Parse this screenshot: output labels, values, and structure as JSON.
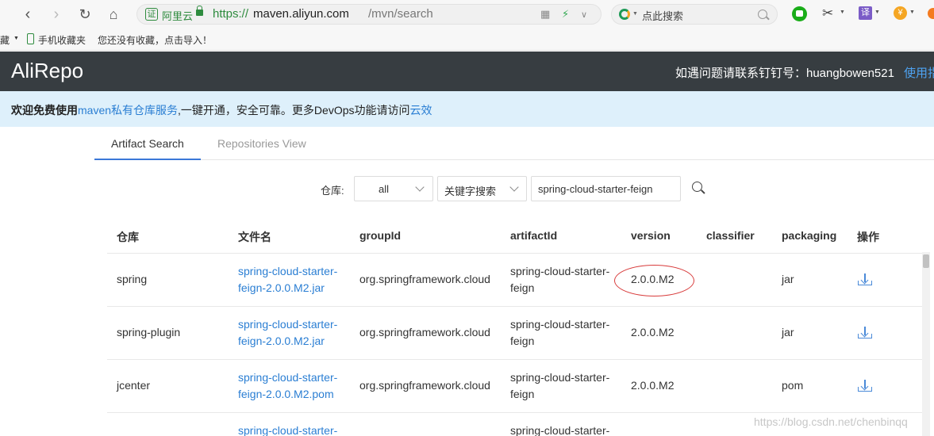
{
  "browser": {
    "site_name": "阿里云",
    "cert_badge": "证",
    "url_scheme": "https://",
    "url_host": "maven.aliyun.com",
    "url_path": "/mvn/search",
    "search_placeholder": "点此搜索",
    "translate_badge": "译",
    "coin_badge": "¥",
    "icons": [
      "back-icon",
      "forward-icon",
      "refresh-icon",
      "home-icon",
      "qr-icon",
      "lightning-icon",
      "chevron-down-icon",
      "search-icon",
      "wechat-icon",
      "scissors-icon",
      "translate-icon",
      "coin-icon"
    ]
  },
  "bookmarks": {
    "folder_label": "藏",
    "mobile_label": "手机收藏夹",
    "hint": "您还没有收藏，点击导入！"
  },
  "app": {
    "logo": "AliRepo",
    "contact": "如遇问题请联系钉钉号：huangbowen521",
    "help_link": "使用指南"
  },
  "notice": {
    "prefix": "欢迎免费使用",
    "link1": "maven私有仓库服务",
    "middle": ",一键开通，安全可靠。更多DevOps功能请访问",
    "link2": "云效"
  },
  "tabs": [
    {
      "label": "Artifact Search",
      "active": true
    },
    {
      "label": "Repositories View",
      "active": false
    }
  ],
  "search": {
    "repo_label": "仓库:",
    "repo_value": "all",
    "mode_value": "关键字搜索",
    "keyword": "spring-cloud-starter-feign"
  },
  "table": {
    "columns": [
      "仓库",
      "文件名",
      "groupId",
      "artifactId",
      "version",
      "classifier",
      "packaging",
      "操作"
    ],
    "rows": [
      {
        "repo": "spring",
        "file_line1": "spring-cloud-starter-",
        "file_line2": "feign-2.0.0.M2.jar",
        "group": "org.springframework.cloud",
        "artifact_line1": "spring-cloud-starter-",
        "artifact_line2": "feign",
        "version": "2.0.0.M2",
        "classifier": "",
        "packaging": "jar"
      },
      {
        "repo": "spring-plugin",
        "file_line1": "spring-cloud-starter-",
        "file_line2": "feign-2.0.0.M2.jar",
        "group": "org.springframework.cloud",
        "artifact_line1": "spring-cloud-starter-",
        "artifact_line2": "feign",
        "version": "2.0.0.M2",
        "classifier": "",
        "packaging": "jar"
      },
      {
        "repo": "jcenter",
        "file_line1": "spring-cloud-starter-",
        "file_line2": "feign-2.0.0.M2.pom",
        "group": "org.springframework.cloud",
        "artifact_line1": "spring-cloud-starter-",
        "artifact_line2": "feign",
        "version": "2.0.0.M2",
        "classifier": "",
        "packaging": "pom"
      },
      {
        "repo": "",
        "file_line1": "spring-cloud-starter-",
        "file_line2": "",
        "group": "",
        "artifact_line1": "spring-cloud-starter-",
        "artifact_line2": "",
        "version": "",
        "classifier": "",
        "packaging": ""
      }
    ]
  },
  "watermark": "https://blog.csdn.net/chenbinqq",
  "colors": {
    "header_bg": "#373d41",
    "notice_bg": "#def0fb",
    "link": "#2a7ed3",
    "tab_accent": "#3b78d8",
    "highlight": "#d83b3b"
  }
}
